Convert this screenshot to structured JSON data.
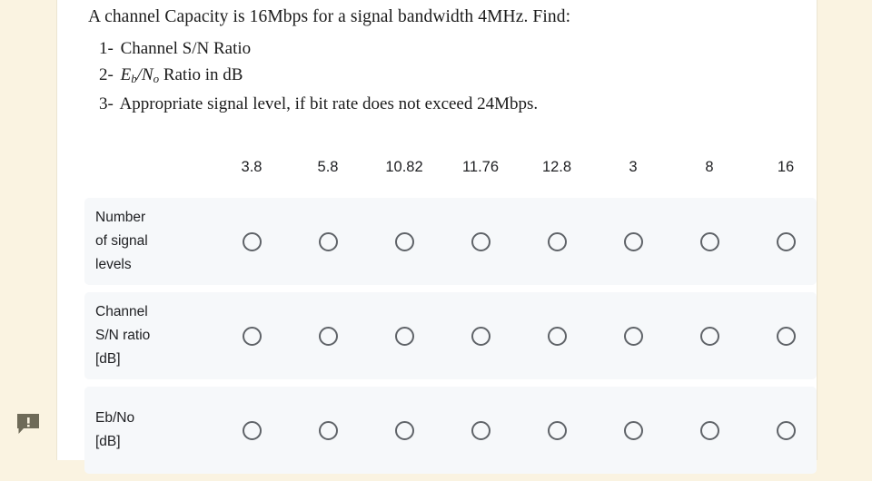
{
  "theme": {
    "page_background": "#faf3e1",
    "card_background": "#ffffff",
    "row_background": "#f6f8fa",
    "radio_border": "#5f6368",
    "text_color": "#202124"
  },
  "question": {
    "stem": "A channel Capacity is 16Mbps for a signal bandwidth 4MHz. Find:",
    "items": [
      {
        "number": "1-",
        "text": "Channel S/N Ratio"
      },
      {
        "number": "2-",
        "math_var_1": "E",
        "math_sub_1": "b",
        "math_sep": "/",
        "math_var_2": "N",
        "math_sub_2": "o",
        "text": "Ratio  in dB"
      },
      {
        "number": "3-",
        "text": "Appropriate signal level, if bit rate does not exceed 24Mbps."
      }
    ]
  },
  "matrix": {
    "columns": [
      "3.8",
      "5.8",
      "10.82",
      "11.76",
      "12.8",
      "3",
      "8",
      "16"
    ],
    "rows": [
      {
        "label": "Number\nof signal\nlevels",
        "selected": null
      },
      {
        "label": "Channel\nS/N ratio\n[dB]",
        "selected": null
      },
      {
        "label": "Eb/No\n[dB]",
        "selected": null
      }
    ]
  },
  "gutter": {
    "feedback_icon": "feedback-speech-bubble-exclamation-icon"
  }
}
